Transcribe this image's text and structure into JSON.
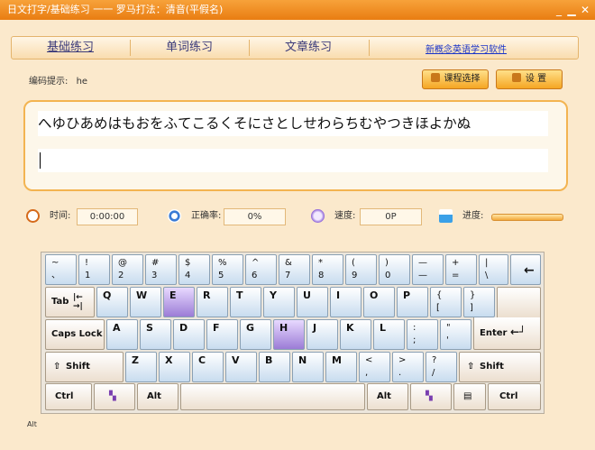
{
  "window": {
    "title": "日文打字/基础练习 一一 罗马打法：清音(平假名)"
  },
  "tabs": [
    {
      "label": "基础练习"
    },
    {
      "label": "单词练习"
    },
    {
      "label": "文章练习"
    }
  ],
  "link_label": "新概念英语学习软件",
  "hint": {
    "label": "编码提示:",
    "value": "he"
  },
  "buttons": {
    "course": "课程选择",
    "settings": "设 置"
  },
  "text": {
    "prompt": "へゆひあめはもおをふてこるくそにさとしせわらちむやつきほよかぬ",
    "input": ""
  },
  "stats": {
    "time_label": "时间:",
    "time_value": "0:00:00",
    "accuracy_label": "正确率:",
    "accuracy_value": "0%",
    "speed_label": "速度:",
    "speed_value": "0P",
    "progress_label": "进度:",
    "progress_fraction": 0
  },
  "colors": {
    "accent": "#f39a28",
    "highlight_key": "#a98ae0",
    "key": "#c8dcef"
  },
  "keyboard": {
    "row1": [
      {
        "top": "~",
        "bottom": "、"
      },
      {
        "top": "!",
        "bottom": "1"
      },
      {
        "top": "@",
        "bottom": "2"
      },
      {
        "top": "#",
        "bottom": "3"
      },
      {
        "top": "$",
        "bottom": "4"
      },
      {
        "top": "%",
        "bottom": "5"
      },
      {
        "top": "^",
        "bottom": "6"
      },
      {
        "top": "&",
        "bottom": "7"
      },
      {
        "top": "*",
        "bottom": "8"
      },
      {
        "top": "(",
        "bottom": "9"
      },
      {
        "top": ")",
        "bottom": "0"
      },
      {
        "top": "—",
        "bottom": "—"
      },
      {
        "top": "+",
        "bottom": "="
      },
      {
        "top": "|",
        "bottom": "\\"
      }
    ],
    "backspace_icon": "left-arrow-icon",
    "row2": [
      "Q",
      "W",
      "E",
      "R",
      "T",
      "Y",
      "U",
      "I",
      "O",
      "P"
    ],
    "row2_punct": [
      {
        "top": "{",
        "bottom": "["
      },
      {
        "top": "}",
        "bottom": "]"
      }
    ],
    "row3": [
      "A",
      "S",
      "D",
      "F",
      "G",
      "H",
      "J",
      "K",
      "L"
    ],
    "row3_punct": [
      {
        "top": ":",
        "bottom": ";"
      },
      {
        "top": "\"",
        "bottom": "'"
      }
    ],
    "row4": [
      "Z",
      "X",
      "C",
      "V",
      "B",
      "N",
      "M"
    ],
    "row4_punct": [
      {
        "top": "<",
        "bottom": ","
      },
      {
        "top": ">",
        "bottom": "."
      },
      {
        "top": "?",
        "bottom": "/"
      }
    ],
    "tab_label": "Tab",
    "caps_label": "Caps Lock",
    "enter_label": "Enter",
    "shift_label": "Shift",
    "ctrl_label": "Ctrl",
    "alt_label": "Alt",
    "highlight": [
      "E",
      "H"
    ]
  },
  "bottom_text": "Alt"
}
